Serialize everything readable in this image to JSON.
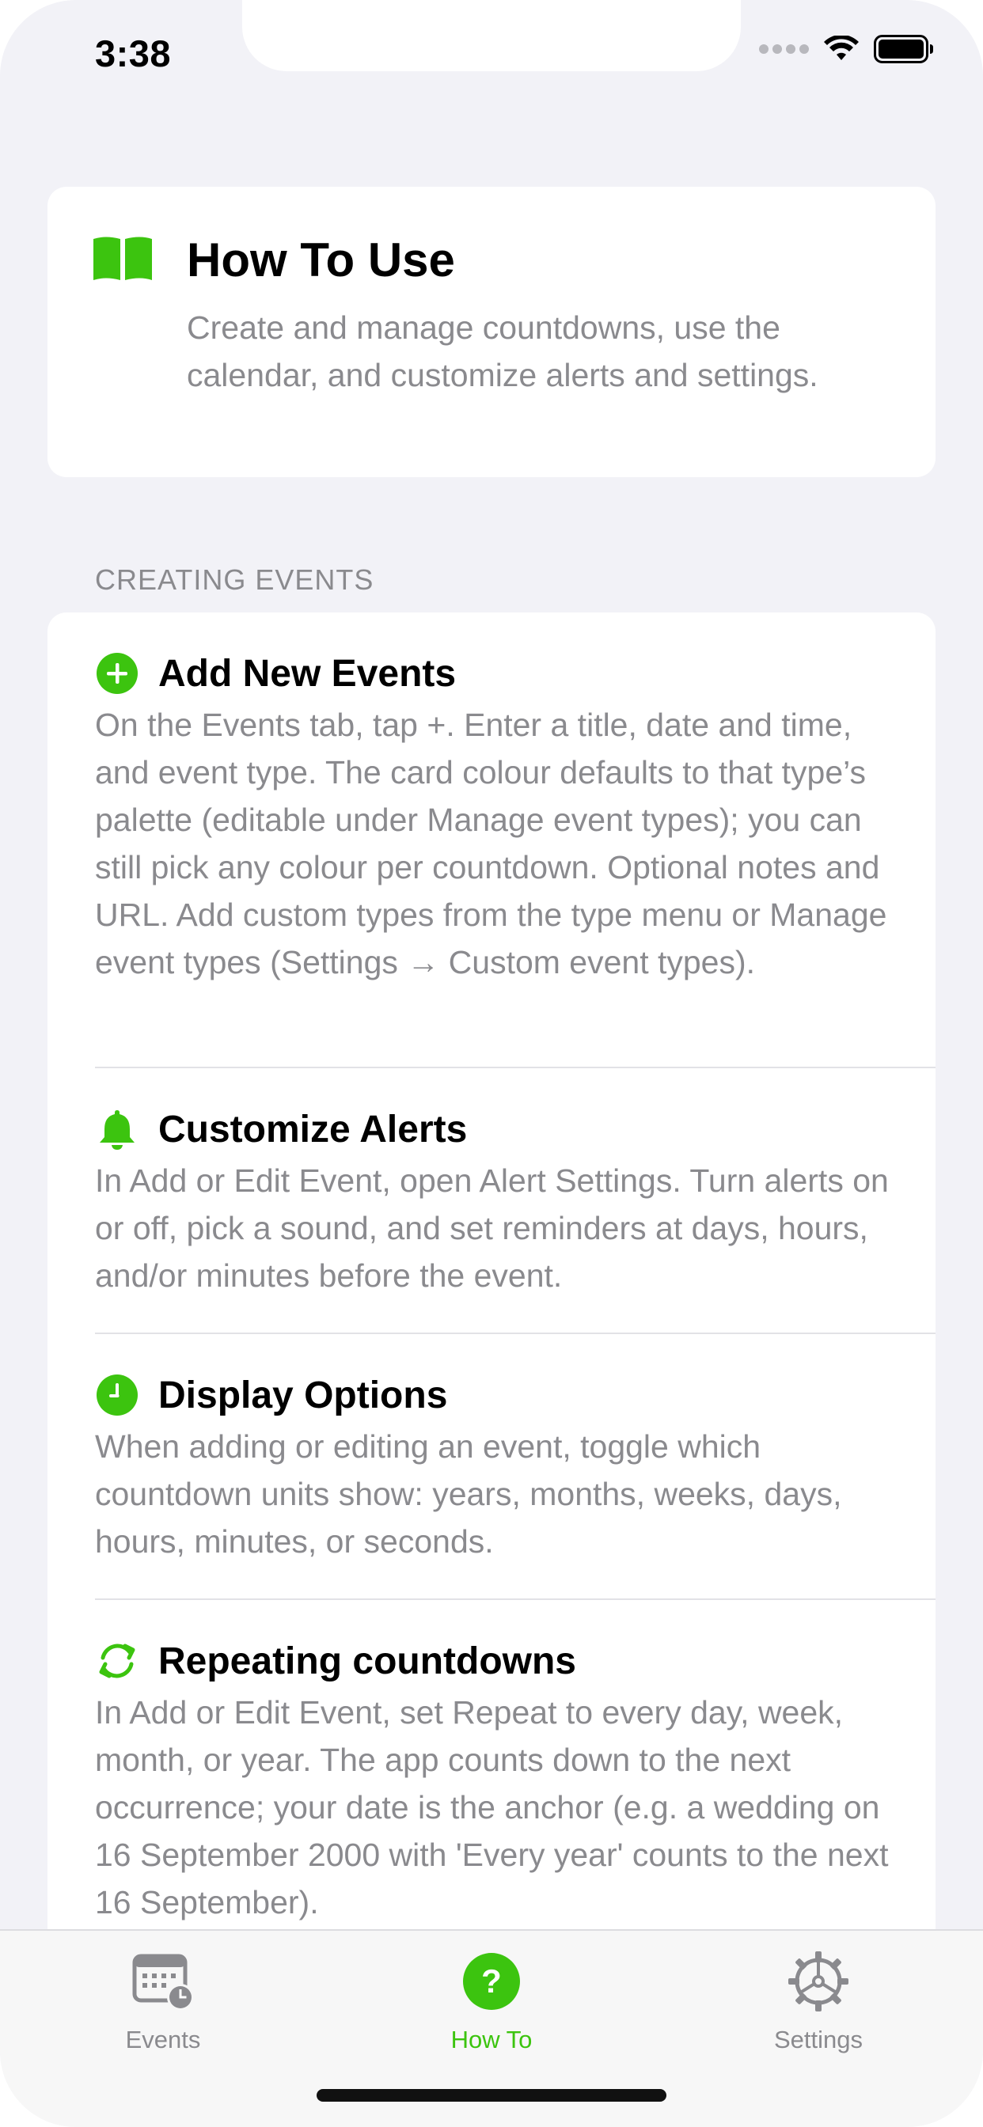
{
  "status_bar": {
    "time": "3:38"
  },
  "header": {
    "title": "How To Use",
    "description": "Create and manage countdowns, use the calendar, and customize alerts and settings.",
    "icon": "book-icon"
  },
  "section": {
    "title": "CREATING EVENTS"
  },
  "items": [
    {
      "title": "Add New Events",
      "icon": "plus-circle-icon",
      "body": "On the Events tab, tap +. Enter a title, date and time, and event type. The card colour defaults to that type’s palette (editable under Manage event types); you can still pick any colour per countdown. Optional notes and URL. Add custom types from the type menu or Manage event types (Settings → Custom event types)."
    },
    {
      "title": "Customize Alerts",
      "icon": "bell-icon",
      "body": "In Add or Edit Event, open Alert Settings. Turn alerts on or off, pick a sound, and set reminders at days, hours, and/or minutes before the event."
    },
    {
      "title": "Display Options",
      "icon": "clock-icon",
      "body": "When adding or editing an event, toggle which countdown units show: years, months, weeks, days, hours, minutes, or seconds."
    },
    {
      "title": "Repeating countdowns",
      "icon": "repeat-icon",
      "body": "In Add or Edit Event, set Repeat to every day, week, month, or year. The app counts down to the next occurrence; your date is the anchor (e.g. a wedding on 16 September 2000 with 'Every year' counts to the next 16 September)."
    }
  ],
  "tabs": [
    {
      "label": "Events",
      "icon": "calendar-clock-icon",
      "active": false
    },
    {
      "label": "How To",
      "icon": "question-circle-icon",
      "active": true
    },
    {
      "label": "Settings",
      "icon": "gear-icon",
      "active": false
    }
  ],
  "colors": {
    "accent": "#3cc40f",
    "background": "#f2f2f7",
    "card": "#ffffff",
    "secondary_text": "#8a8a8e"
  }
}
